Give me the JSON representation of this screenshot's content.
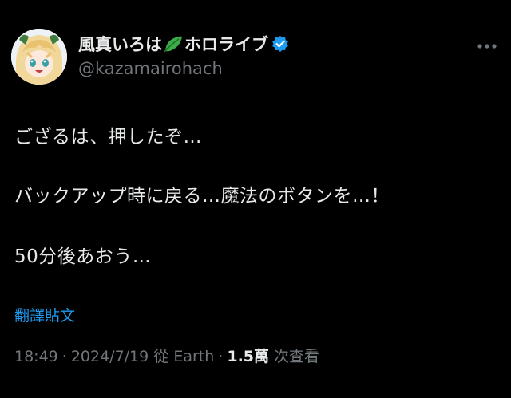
{
  "author": {
    "display_name": "風真いろは",
    "leaf_icon": "leaf-emoji-icon",
    "name_suffix": "ホロライブ",
    "verified_icon": "verified-badge-icon",
    "handle": "@kazamairohach"
  },
  "more_icon": "more-horizontal-icon",
  "tweet": {
    "lines": [
      "ござるは、押したぞ…",
      "バックアップ時に戻る…魔法のボタンを…！",
      "50分後あおう…"
    ]
  },
  "translate_label": "翻譯貼文",
  "meta": {
    "time": "18:49",
    "date": "2024/7/19",
    "source_prefix": "從",
    "source": "Earth",
    "separator": "·",
    "views_count": "1.5萬",
    "views_label": "次查看"
  },
  "colors": {
    "background": "#000000",
    "text": "#e7e9ea",
    "muted": "#71767b",
    "link": "#1d9bf0",
    "verified": "#1d9bf0"
  }
}
